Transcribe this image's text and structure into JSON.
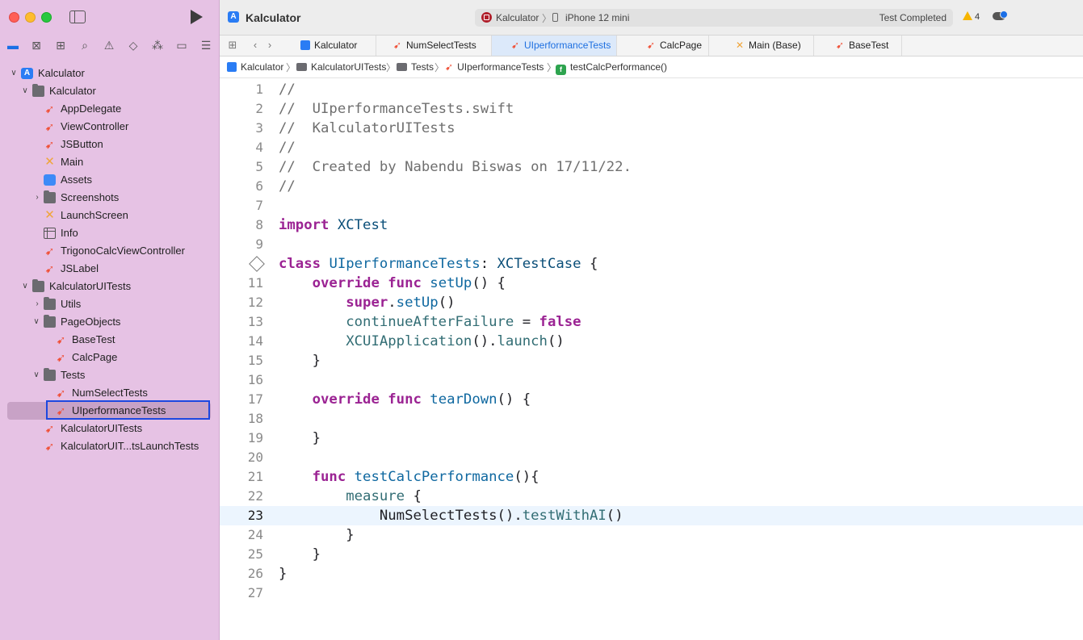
{
  "window": {
    "app_title": "Kalculator",
    "scheme": "Kalculator",
    "scheme_separator": "〉",
    "device": "iPhone 12 mini",
    "status": "Test Completed",
    "warnings": "4"
  },
  "tabs": [
    {
      "label": "Kalculator",
      "icon": "project-icon"
    },
    {
      "label": "NumSelectTests",
      "icon": "swift-icon"
    },
    {
      "label": "UIperformanceTests",
      "icon": "swift-icon"
    },
    {
      "label": "CalcPage",
      "icon": "swift-icon"
    },
    {
      "label": "Main (Base)",
      "icon": "interface-builder-icon"
    },
    {
      "label": "BaseTest",
      "icon": "swift-icon"
    }
  ],
  "breadcrumb": [
    "Kalculator",
    "KalculatorUITests",
    "Tests",
    "UIperformanceTests",
    "testCalcPerformance()"
  ],
  "breadcrumb_separator": "〉",
  "navigator": [
    {
      "label": "Kalculator",
      "icon": "project-icon"
    },
    {
      "label": "Kalculator",
      "icon": "folder-icon"
    },
    {
      "label": "AppDelegate",
      "icon": "swift-icon"
    },
    {
      "label": "ViewController",
      "icon": "swift-icon"
    },
    {
      "label": "JSButton",
      "icon": "swift-icon"
    },
    {
      "label": "Main",
      "icon": "interface-builder-icon"
    },
    {
      "label": "Assets",
      "icon": "assets-icon"
    },
    {
      "label": "Screenshots",
      "icon": "folder-icon"
    },
    {
      "label": "LaunchScreen",
      "icon": "interface-builder-icon"
    },
    {
      "label": "Info",
      "icon": "plist-icon"
    },
    {
      "label": "TrigonoCalcViewController",
      "icon": "swift-icon"
    },
    {
      "label": "JSLabel",
      "icon": "swift-icon"
    },
    {
      "label": "KalculatorUITests",
      "icon": "folder-icon"
    },
    {
      "label": "Utils",
      "icon": "folder-icon"
    },
    {
      "label": "PageObjects",
      "icon": "folder-icon"
    },
    {
      "label": "BaseTest",
      "icon": "swift-icon"
    },
    {
      "label": "CalcPage",
      "icon": "swift-icon"
    },
    {
      "label": "Tests",
      "icon": "folder-icon"
    },
    {
      "label": "NumSelectTests",
      "icon": "swift-icon"
    },
    {
      "label": "UIperformanceTests",
      "icon": "swift-icon"
    },
    {
      "label": "KalculatorUITests",
      "icon": "swift-icon"
    },
    {
      "label": "KalculatorUIT...tsLaunchTests",
      "icon": "swift-icon"
    }
  ],
  "editor": {
    "current_line": 23,
    "lines": [
      {
        "n": "1",
        "t": "//"
      },
      {
        "n": "2",
        "t": "//  UIperformanceTests.swift"
      },
      {
        "n": "3",
        "t": "//  KalculatorUITests"
      },
      {
        "n": "4",
        "t": "//"
      },
      {
        "n": "5",
        "t": "//  Created by Nabendu Biswas on 17/11/22."
      },
      {
        "n": "6",
        "t": "//"
      },
      {
        "n": "7",
        "t": ""
      },
      {
        "n": "8",
        "t": "import XCTest"
      },
      {
        "n": "9",
        "t": ""
      },
      {
        "n": "",
        "t": "class UIperformanceTests: XCTestCase {"
      },
      {
        "n": "11",
        "t": "    override func setUp() {"
      },
      {
        "n": "12",
        "t": "        super.setUp()"
      },
      {
        "n": "13",
        "t": "        continueAfterFailure = false"
      },
      {
        "n": "14",
        "t": "        XCUIApplication().launch()"
      },
      {
        "n": "15",
        "t": "    }"
      },
      {
        "n": "16",
        "t": ""
      },
      {
        "n": "17",
        "t": "    override func tearDown() {"
      },
      {
        "n": "18",
        "t": ""
      },
      {
        "n": "19",
        "t": "    }"
      },
      {
        "n": "20",
        "t": ""
      },
      {
        "n": "21",
        "t": "    func testCalcPerformance(){"
      },
      {
        "n": "22",
        "t": "        measure {"
      },
      {
        "n": "23",
        "t": "            NumSelectTests().testWithAI()"
      },
      {
        "n": "24",
        "t": "        }"
      },
      {
        "n": "25",
        "t": "    }"
      },
      {
        "n": "26",
        "t": "}"
      },
      {
        "n": "27",
        "t": ""
      }
    ]
  },
  "colors": {
    "sidebar_bg": "#e6c2e4",
    "accent": "#1d6fe0",
    "keyword": "#9b2393",
    "comment": "#6f6f6f",
    "type": "#0b4f79",
    "function": "#326d74"
  }
}
